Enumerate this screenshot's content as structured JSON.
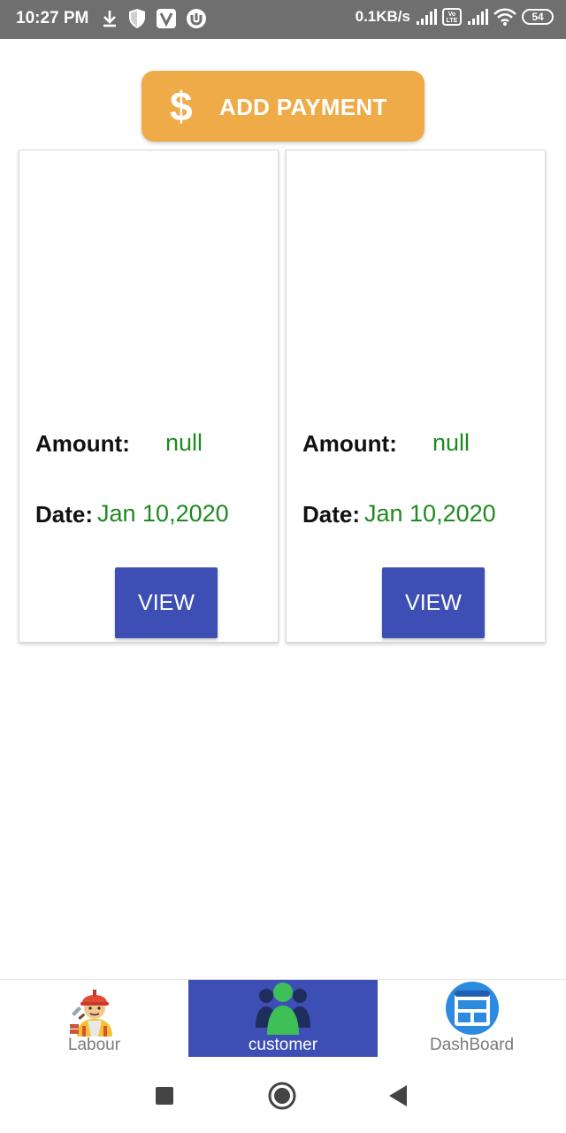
{
  "status_bar": {
    "time": "10:27 PM",
    "network_speed": "0.1KB/s",
    "battery": "54"
  },
  "add_payment": {
    "icon_glyph": "$",
    "label": "ADD PAYMENT",
    "color": "#eeab48"
  },
  "payments": [
    {
      "amount_label": "Amount:",
      "amount_value": "null",
      "date_label": "Date:",
      "date_value": "Jan 10,2020",
      "view_label": "VIEW"
    },
    {
      "amount_label": "Amount:",
      "amount_value": "null",
      "date_label": "Date:",
      "date_value": "Jan 10,2020",
      "view_label": "VIEW"
    }
  ],
  "bottom_nav": {
    "items": [
      {
        "label": "Labour",
        "icon": "labour-worker-icon"
      },
      {
        "label": "customer",
        "icon": "customer-group-icon",
        "active": true
      },
      {
        "label": "DashBoard",
        "icon": "dashboard-icon"
      }
    ],
    "active_color": "#3d4fb5"
  },
  "colors": {
    "accent": "#3d4fb5",
    "value_green": "#1f8a1f",
    "status_bar": "#6f6f6f"
  }
}
